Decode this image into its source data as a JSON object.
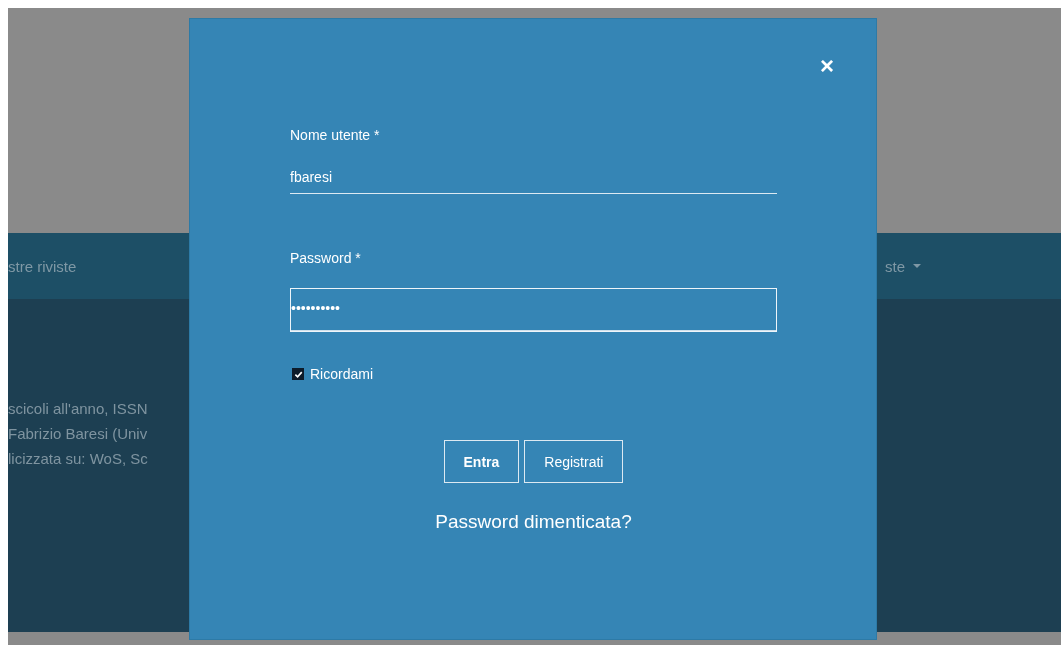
{
  "background": {
    "nav_items": [
      {
        "label": "stre riviste",
        "dropdown": false
      },
      {
        "label": "ste",
        "dropdown": true
      }
    ],
    "description_lines": [
      "scicoli all'anno, ISSN",
      "Fabrizio Baresi (Univ",
      "licizzata su: WoS, Sc"
    ]
  },
  "dialog": {
    "close": "×",
    "fields": [
      {
        "kind": "text",
        "label": "Nome utente *",
        "value": "fbaresi",
        "focused": false
      },
      {
        "kind": "password",
        "label": "Password *",
        "value": "••••••••••",
        "focused": true
      }
    ],
    "remember": {
      "label": "Ricordami",
      "checked": true
    },
    "buttons": [
      {
        "label": "Entra",
        "primary": true
      },
      {
        "label": "Registrati",
        "primary": false
      }
    ],
    "forgot_link": "Password dimenticata?"
  }
}
